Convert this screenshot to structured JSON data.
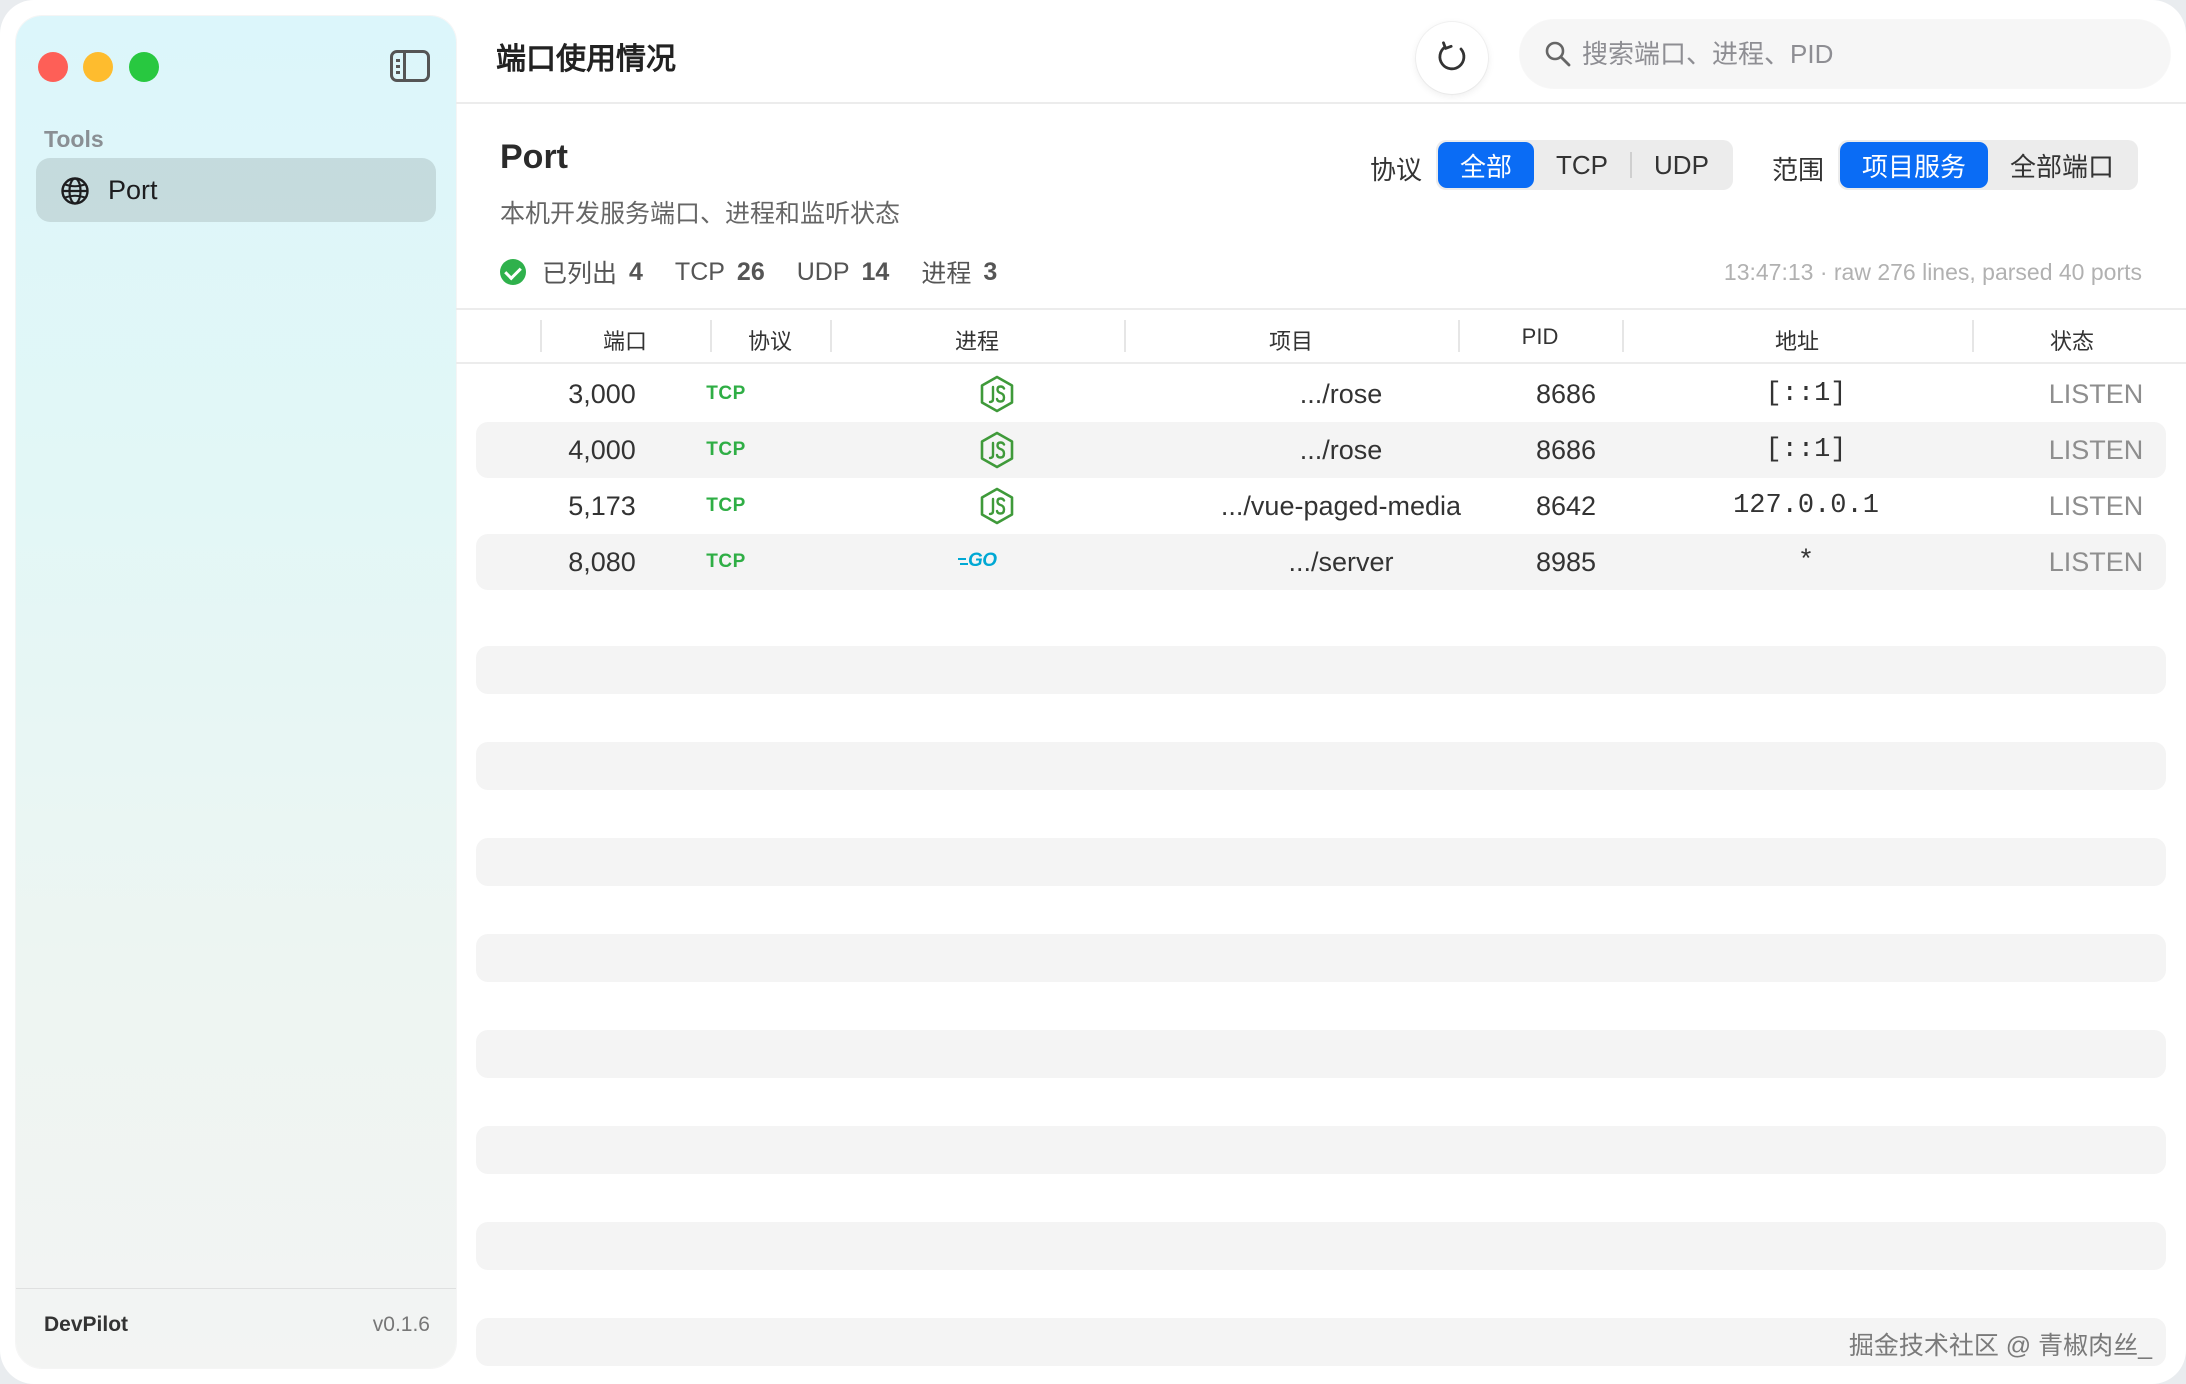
{
  "sidebar": {
    "section_label": "Tools",
    "items": [
      {
        "label": "Port",
        "icon": "globe-icon"
      }
    ],
    "footer": {
      "app_name": "DevPilot",
      "version": "v0.1.6"
    }
  },
  "topbar": {
    "title": "端口使用情况",
    "search_placeholder": "搜索端口、进程、PID"
  },
  "header": {
    "title": "Port",
    "subtitle": "本机开发服务端口、进程和监听状态",
    "protocol_filter": {
      "label": "协议",
      "options": [
        "全部",
        "TCP",
        "UDP"
      ],
      "selected": "全部"
    },
    "scope_filter": {
      "label": "范围",
      "options": [
        "项目服务",
        "全部端口"
      ],
      "selected": "项目服务"
    },
    "stats": {
      "listed_label": "已列出",
      "listed": "4",
      "tcp_label": "TCP",
      "tcp": "26",
      "udp_label": "UDP",
      "udp": "14",
      "process_label": "进程",
      "process": "3"
    },
    "meta": "13:47:13 · raw 276 lines, parsed 40 ports"
  },
  "table": {
    "columns": [
      "端口",
      "协议",
      "进程",
      "项目",
      "PID",
      "地址",
      "状态"
    ],
    "rows": [
      {
        "port": "3,000",
        "protocol": "TCP",
        "process_icon": "nodejs-icon",
        "project": ".../rose",
        "pid": "8686",
        "address": "[::1]",
        "state": "LISTEN"
      },
      {
        "port": "4,000",
        "protocol": "TCP",
        "process_icon": "nodejs-icon",
        "project": ".../rose",
        "pid": "8686",
        "address": "[::1]",
        "state": "LISTEN"
      },
      {
        "port": "5,173",
        "protocol": "TCP",
        "process_icon": "nodejs-icon",
        "project": ".../vue-paged-media",
        "pid": "8642",
        "address": "127.0.0.1",
        "state": "LISTEN"
      },
      {
        "port": "8,080",
        "protocol": "TCP",
        "process_icon": "go-icon",
        "process_text": "GO",
        "project": ".../server",
        "pid": "8985",
        "address": "*",
        "state": "LISTEN"
      }
    ]
  },
  "watermark": "掘金技术社区 @ 青椒肉丝_",
  "colors": {
    "accent": "#0a6cf5",
    "tcp": "#2fae45",
    "node": "#3f9a3a",
    "go": "#00a8d4"
  }
}
